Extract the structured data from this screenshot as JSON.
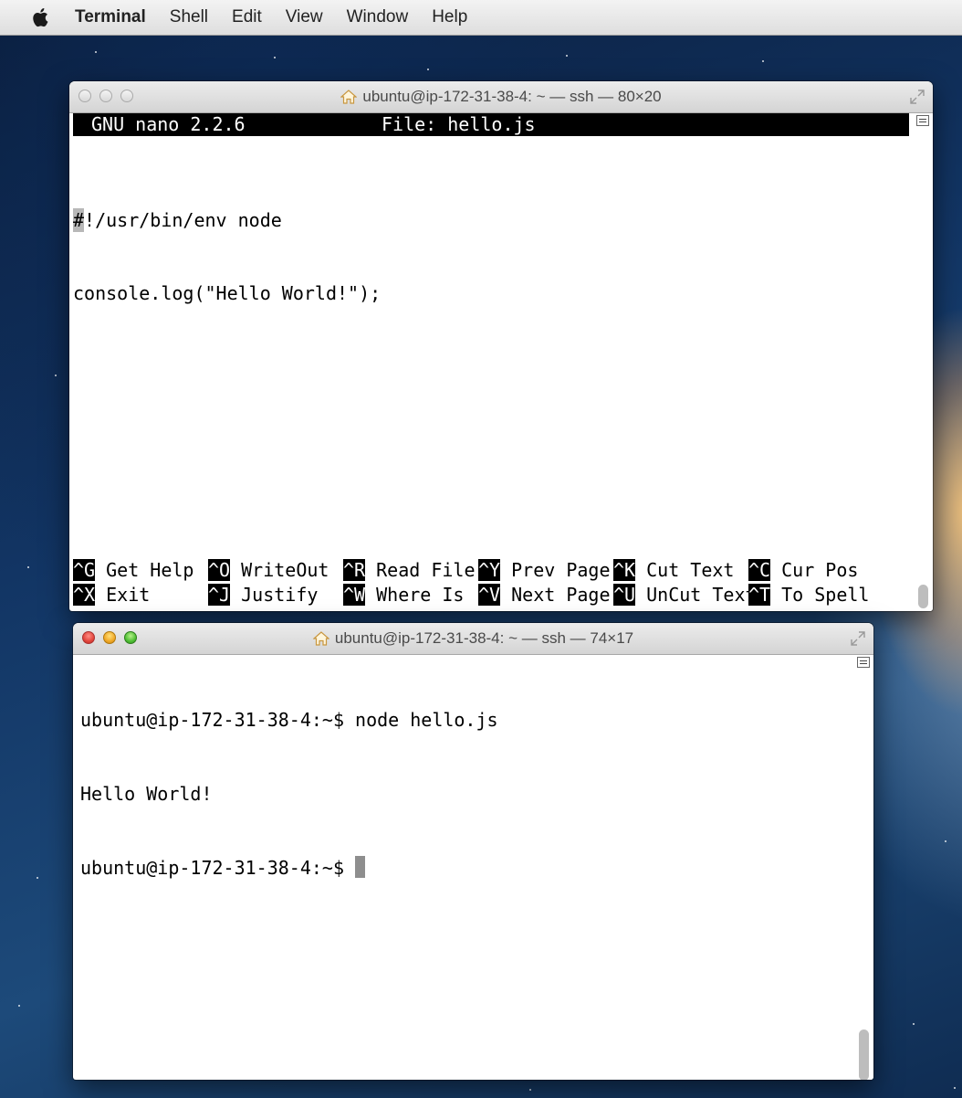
{
  "menubar": {
    "app_name": "Terminal",
    "items": [
      "Shell",
      "Edit",
      "View",
      "Window",
      "Help"
    ]
  },
  "nano_window": {
    "title": "ubuntu@ip-172-31-38-4: ~ — ssh — 80×20",
    "header_version": "GNU nano 2.2.6",
    "header_file": "File: hello.js",
    "cursor_char": "#",
    "line1_rest": "!/usr/bin/env node",
    "line2": "console.log(\"Hello World!\");",
    "shortcuts_row1": [
      {
        "key": "^G",
        "label": "Get Help"
      },
      {
        "key": "^O",
        "label": "WriteOut"
      },
      {
        "key": "^R",
        "label": "Read File"
      },
      {
        "key": "^Y",
        "label": "Prev Page"
      },
      {
        "key": "^K",
        "label": "Cut Text"
      },
      {
        "key": "^C",
        "label": "Cur Pos"
      }
    ],
    "shortcuts_row2": [
      {
        "key": "^X",
        "label": "Exit"
      },
      {
        "key": "^J",
        "label": "Justify"
      },
      {
        "key": "^W",
        "label": "Where Is"
      },
      {
        "key": "^V",
        "label": "Next Page"
      },
      {
        "key": "^U",
        "label": "UnCut Text"
      },
      {
        "key": "^T",
        "label": "To Spell"
      }
    ]
  },
  "shell_window": {
    "title": "ubuntu@ip-172-31-38-4: ~ — ssh — 74×17",
    "lines": [
      "ubuntu@ip-172-31-38-4:~$ node hello.js",
      "Hello World!",
      "ubuntu@ip-172-31-38-4:~$ "
    ]
  }
}
